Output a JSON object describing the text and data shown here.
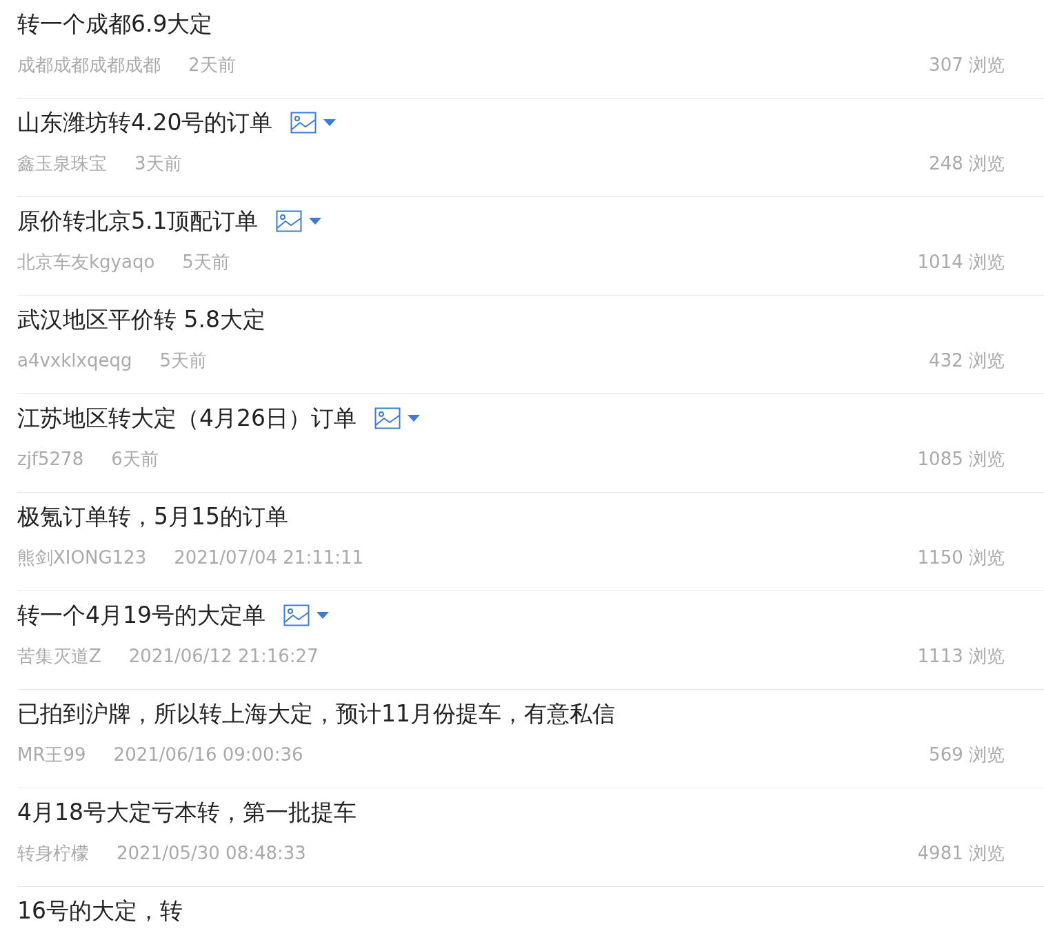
{
  "posts": [
    {
      "title": "转一个成都6.9大定",
      "has_image": false,
      "author": "成都成都成都成都",
      "time": "2天前",
      "views": "307 浏览"
    },
    {
      "title": "山东潍坊转4.20号的订单",
      "has_image": true,
      "author": "鑫玉泉珠宝",
      "time": "3天前",
      "views": "248 浏览"
    },
    {
      "title": "原价转北京5.1顶配订单",
      "has_image": true,
      "author": "北京车友kgyaqo",
      "time": "5天前",
      "views": "1014 浏览"
    },
    {
      "title": "武汉地区平价转 5.8大定",
      "has_image": false,
      "author": "a4vxklxqeqg",
      "time": "5天前",
      "views": "432 浏览"
    },
    {
      "title": "江苏地区转大定（4月26日）订单",
      "has_image": true,
      "author": "zjf5278",
      "time": "6天前",
      "views": "1085 浏览"
    },
    {
      "title": "极氪订单转，5月15的订单",
      "has_image": false,
      "author": "熊剑XIONG123",
      "time": "2021/07/04 21:11:11",
      "views": "1150 浏览"
    },
    {
      "title": "转一个4月19号的大定单",
      "has_image": true,
      "author": "苦集灭道Z",
      "time": "2021/06/12 21:16:27",
      "views": "1113 浏览"
    },
    {
      "title": "已拍到沪牌，所以转上海大定，预计11月份提车，有意私信",
      "has_image": false,
      "author": "MR王99",
      "time": "2021/06/16 09:00:36",
      "views": "569 浏览"
    },
    {
      "title": "4月18号大定亏本转，第一批提车",
      "has_image": false,
      "author": "转身柠檬",
      "time": "2021/05/30 08:48:33",
      "views": "4981 浏览"
    },
    {
      "title": "16号的大定，转",
      "has_image": false
    }
  ]
}
